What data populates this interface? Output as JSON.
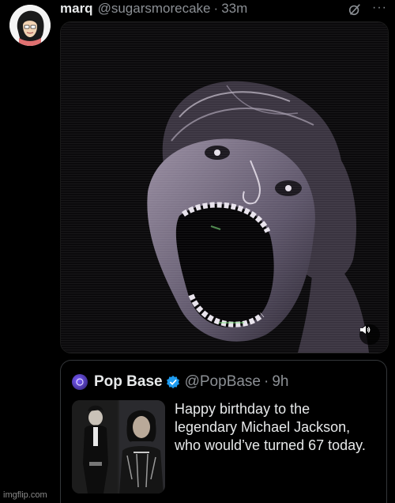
{
  "post": {
    "author_name": "marq",
    "author_handle": "@sugarsmorecake",
    "separator": "·",
    "time": "33m",
    "media": {
      "type": "video",
      "sound_icon": "speaker-icon"
    },
    "icons": {
      "grok": "grok-icon",
      "more": "more-icon",
      "more_glyph": "···"
    }
  },
  "quoted_post": {
    "author_name": "Pop Base",
    "author_handle": "@PopBase",
    "separator": "·",
    "time": "9h",
    "verified": true,
    "text_lines": [
      "Happy birthday to the",
      "legendary Michael Jackson,",
      "who would’ve turned 67 today."
    ]
  },
  "watermark": "imgflip.com",
  "colors": {
    "background": "#000000",
    "text_primary": "#e7e9ea",
    "text_secondary": "#8b8f94",
    "verified_blue": "#1d9bf0",
    "border": "#333639"
  }
}
